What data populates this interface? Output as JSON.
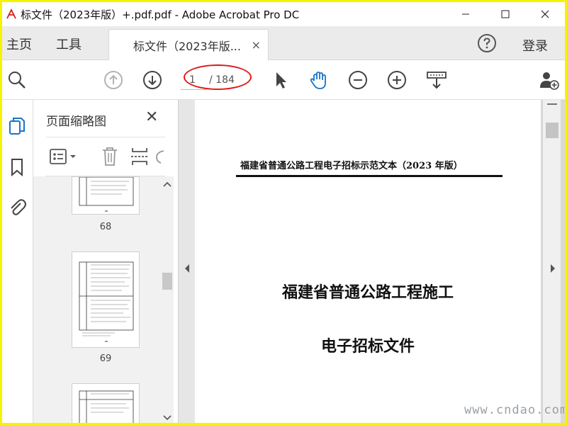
{
  "window": {
    "title": "标文件（2023年版）+.pdf.pdf - Adobe Acrobat Pro DC",
    "minimize": "—",
    "maximize": "☐",
    "close": "✕"
  },
  "tabs": {
    "home": "主页",
    "tools": "工具",
    "document": "标文件（2023年版...",
    "document_close": "×",
    "login": "登录"
  },
  "toolbar": {
    "current_page": "1",
    "total_pages": "/ 184"
  },
  "thumbnails": {
    "title": "页面缩略图",
    "close": "✕",
    "pages": [
      "68",
      "69"
    ]
  },
  "document": {
    "header": "福建省普通公路工程电子招标示范文本（2023 年版）",
    "title_line1": "福建省普通公路工程施工",
    "title_line2": "电子招标文件"
  },
  "watermark": "www.cndao.com",
  "colors": {
    "accent_blue": "#1a73c8",
    "highlight_oval": "#e01818",
    "frame_border": "#f6f200"
  },
  "icons": {
    "zoom": "magnifier-icon",
    "prev": "arrow-up-circle-icon",
    "next": "arrow-down-circle-icon",
    "select": "cursor-arrow-icon",
    "hand": "hand-pan-icon",
    "zoom_out": "minus-circle-icon",
    "zoom_in": "plus-circle-icon",
    "scroll": "scrolling-mode-icon",
    "share": "add-user-icon"
  }
}
